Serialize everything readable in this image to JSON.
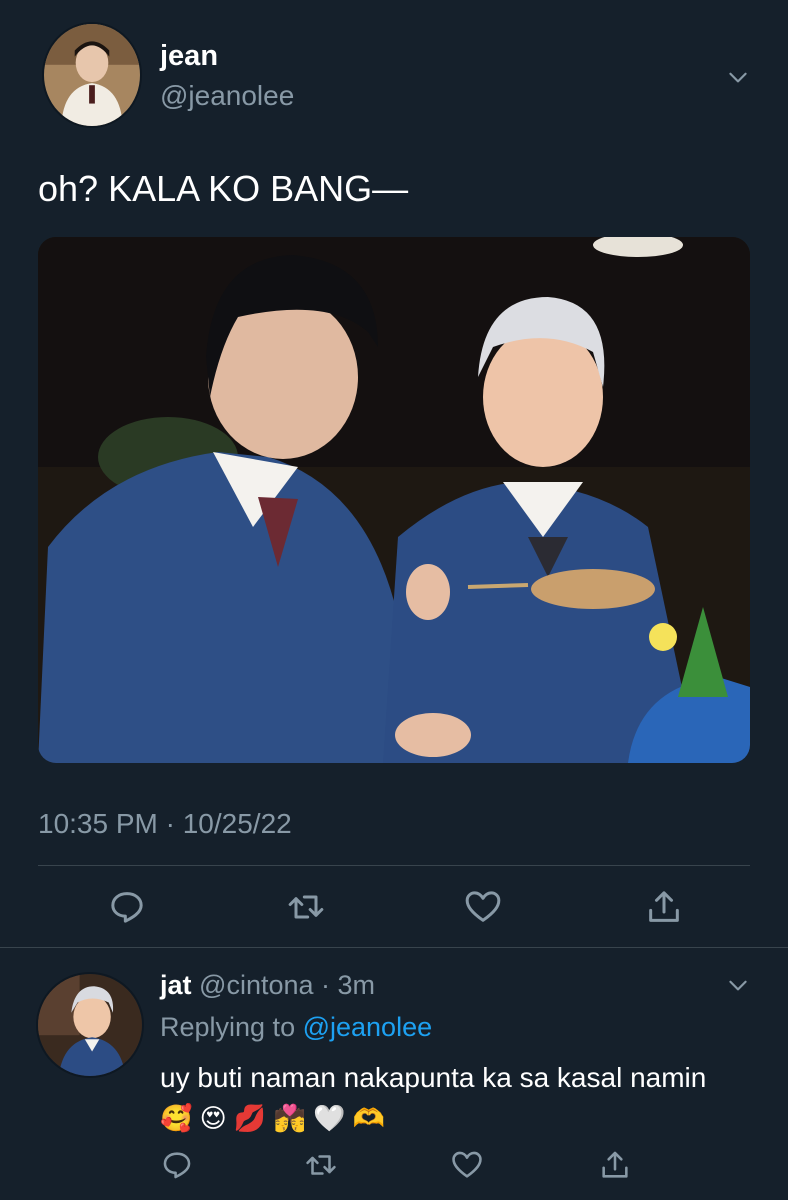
{
  "tweet": {
    "author_name": "jean",
    "author_handle": "@jeanolee",
    "text": "oh? KALA KO BANG—",
    "timestamp": "10:35 PM · 10/25/22",
    "media_alt": "photo"
  },
  "reply": {
    "author_name": "jat",
    "author_handle": "@cintona",
    "separator": " · ",
    "time_ago": "3m",
    "replying_prefix": "Replying to ",
    "replying_to": "@jeanolee",
    "text": "uy buti naman nakapunta ka sa kasal namin",
    "emojis": "🥰 😍 💋 💏 🤍 🫶"
  },
  "icons": {
    "reply": "reply-icon",
    "retweet": "retweet-icon",
    "like": "heart-icon",
    "share": "share-icon",
    "more": "chevron-down-icon"
  },
  "colors": {
    "background": "#15202b",
    "text": "#ffffff",
    "secondary": "#8899a6",
    "link": "#1da1f2",
    "divider": "#38444d"
  }
}
